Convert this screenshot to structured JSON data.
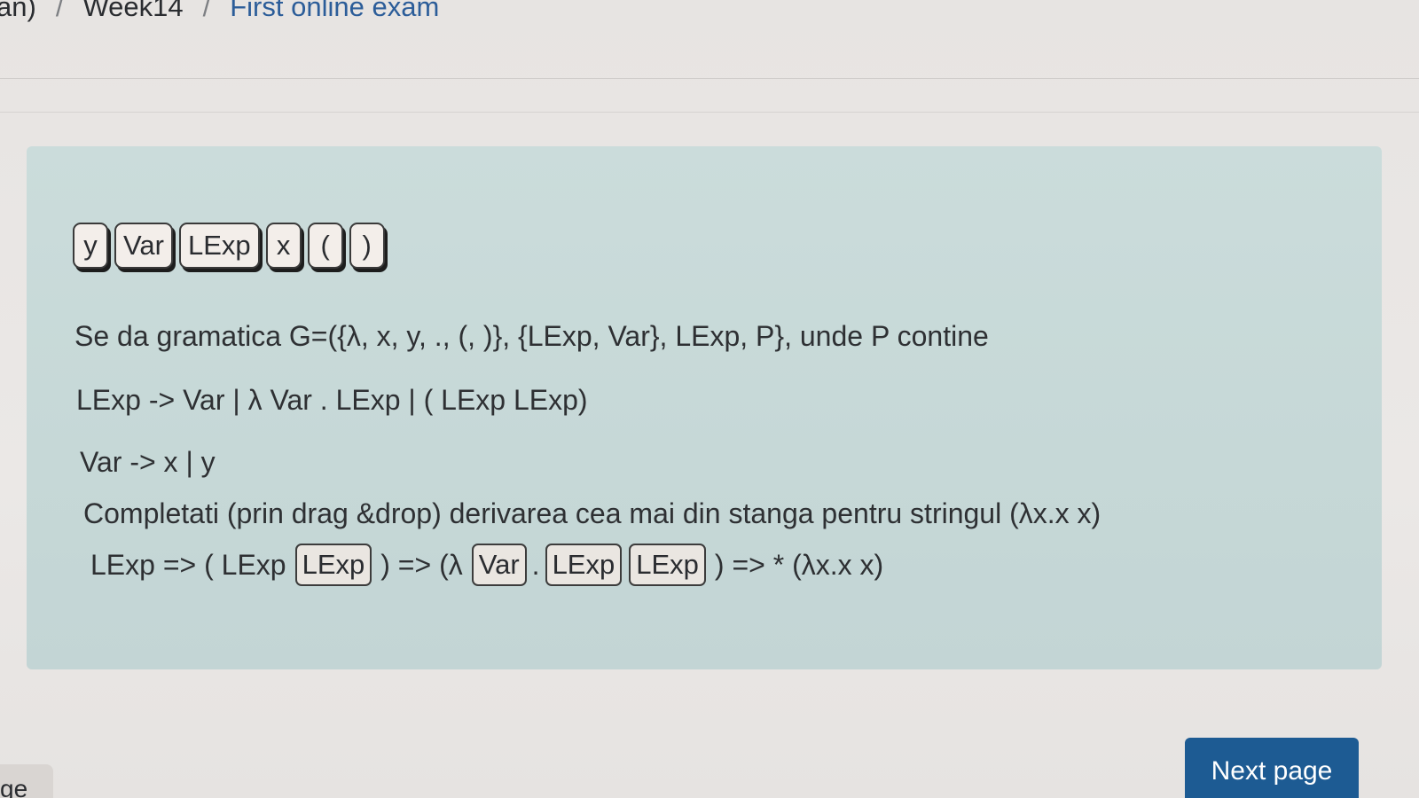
{
  "breadcrumb": {
    "items": [
      "an)",
      "Week14",
      "First online exam"
    ],
    "separator": "/"
  },
  "question": {
    "drag_items": [
      "y",
      "Var",
      "LExp",
      "x",
      "(",
      ")"
    ],
    "text_line1": "Se da gramatica G=({λ, x, y, ., (, )}, {LExp, Var}, LExp, P}, unde P contine",
    "text_line2": "LExp -> Var | λ Var . LExp | ( LExp LExp)",
    "text_line3": "Var -> x | y",
    "text_line4": "Completati (prin drag &drop) derivarea cea mai din stanga pentru stringul (λx.x   x)",
    "derivation": {
      "seg1": "LExp => ( LExp",
      "slot1": "LExp",
      "seg2": ") => (λ",
      "slot2": "Var",
      "seg3": ".",
      "slot3": "LExp",
      "slot4": "LExp",
      "seg4": ") => *  (λx.x   x)"
    }
  },
  "footer": {
    "next_button_label": "Next page",
    "corner_tab_label": "ge"
  },
  "colors": {
    "question_box_bg": "#c6d8d7",
    "breadcrumb_link": "#2c5d99",
    "primary_button": "#1d5b93"
  }
}
